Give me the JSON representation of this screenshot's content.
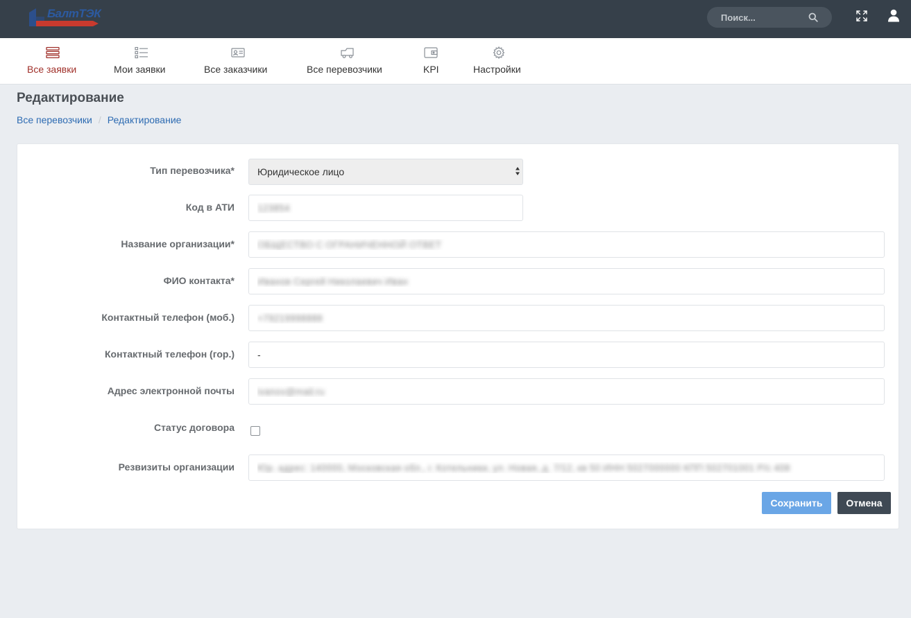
{
  "header": {
    "logo_text": "БалтТЭК",
    "search_placeholder": "Поиск..."
  },
  "nav": {
    "items": [
      {
        "label": "Все заявки",
        "icon": "stack-icon",
        "active": true
      },
      {
        "label": "Мои заявки",
        "icon": "list-icon",
        "active": false
      },
      {
        "label": "Все заказчики",
        "icon": "id-card-icon",
        "active": false
      },
      {
        "label": "Все перевозчики",
        "icon": "truck-icon",
        "active": false
      },
      {
        "label": "KPI",
        "icon": "wallet-icon",
        "active": false
      },
      {
        "label": "Настройки",
        "icon": "gear-icon",
        "active": false
      }
    ]
  },
  "page": {
    "title": "Редактирование",
    "breadcrumb": [
      "Все перевозчики",
      "Редактирование"
    ]
  },
  "form": {
    "carrier_type": {
      "label": "Тип перевозчика*",
      "value": "Юридическое лицо"
    },
    "ati_code": {
      "label": "Код в АТИ",
      "value": "123854"
    },
    "org_name": {
      "label": "Название организации*",
      "value": "ОБЩЕСТВО С ОГРАНИЧЕННОЙ ОТВЕТ"
    },
    "contact_name": {
      "label": "ФИО контакта*",
      "value": "Иванов Сергей Николаевич Иван"
    },
    "mobile_phone": {
      "label": "Контактный телефон (моб.)",
      "value": "+79219998888"
    },
    "city_phone": {
      "label": "Контактный телефон (гор.)",
      "value": "-"
    },
    "email": {
      "label": "Адрес электронной почты",
      "value": "ivanov@mail.ru"
    },
    "contract_status": {
      "label": "Статус договора",
      "checked": false
    },
    "requisites": {
      "label": "Резвизиты организации",
      "value": "Юр. адрес: 140000, Московская обл., г. Котельники, ул. Новая, д. 7/12, кв 50 ИНН 5027000000 КПП 502701001 Р/с 408"
    }
  },
  "buttons": {
    "save": "Сохранить",
    "cancel": "Отмена"
  },
  "colors": {
    "topbar": "#36404a",
    "active_nav": "#a0302a",
    "link": "#2d6bb2",
    "save": "#6aa6e6",
    "cancel": "#3f4954"
  }
}
